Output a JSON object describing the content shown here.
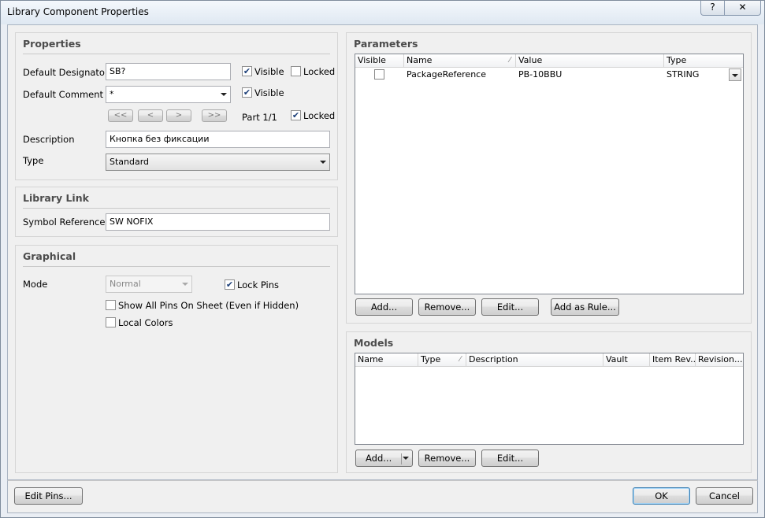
{
  "window": {
    "title": "Library Component Properties",
    "help_label": "?",
    "close_label": "✕"
  },
  "properties": {
    "title": "Properties",
    "designator_label": "Default Designator",
    "designator_value": "SB?",
    "designator_visible_label": "Visible",
    "designator_visible_checked": true,
    "designator_locked_label": "Locked",
    "designator_locked_checked": false,
    "comment_label": "Default Comment",
    "comment_value": "*",
    "comment_visible_label": "Visible",
    "comment_visible_checked": true,
    "nav_first": "<<",
    "nav_prev": "<",
    "nav_next": ">",
    "nav_last": ">>",
    "part_label": "Part 1/1",
    "part_locked_label": "Locked",
    "part_locked_checked": true,
    "description_label": "Description",
    "description_value": "Кнопка без фиксации",
    "type_label": "Type",
    "type_value": "Standard"
  },
  "library_link": {
    "title": "Library Link",
    "symbol_reference_label": "Symbol Reference",
    "symbol_reference_value": "SW NOFIX"
  },
  "graphical": {
    "title": "Graphical",
    "mode_label": "Mode",
    "mode_value": "Normal",
    "lock_pins_label": "Lock Pins",
    "lock_pins_checked": true,
    "show_all_pins_label": "Show All Pins On Sheet (Even if Hidden)",
    "show_all_pins_checked": false,
    "local_colors_label": "Local Colors",
    "local_colors_checked": false
  },
  "parameters": {
    "title": "Parameters",
    "columns": [
      "Visible",
      "Name",
      "Value",
      "Type"
    ],
    "rows": [
      {
        "visible": false,
        "name": "PackageReference",
        "value": "PB-10BBU",
        "type": "STRING"
      }
    ],
    "add_label": "Add...",
    "remove_label": "Remove...",
    "edit_label": "Edit...",
    "add_rule_label": "Add as Rule..."
  },
  "models": {
    "title": "Models",
    "columns": [
      "Name",
      "Type",
      "Description",
      "Vault",
      "Item Rev...",
      "Revision..."
    ],
    "add_label": "Add...",
    "remove_label": "Remove...",
    "edit_label": "Edit..."
  },
  "footer": {
    "edit_pins_label": "Edit Pins...",
    "ok_label": "OK",
    "cancel_label": "Cancel"
  }
}
